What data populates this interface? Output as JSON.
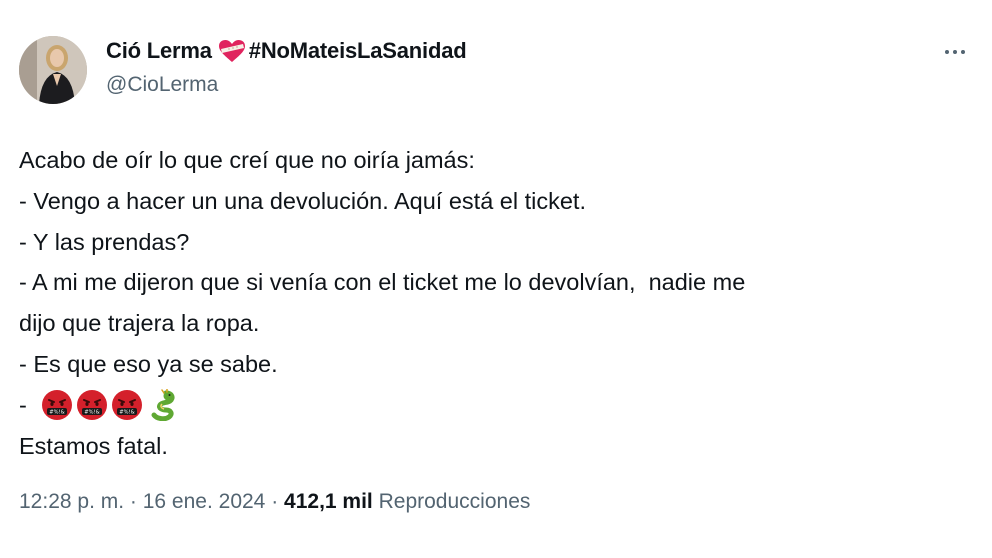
{
  "author": {
    "name": "Ció Lerma",
    "hashtag": "#NoMateisLaSanidad",
    "handle": "@CioLerma",
    "avatar_icon": "profile-photo"
  },
  "tweet": {
    "lines": [
      "Acabo de oír lo que creí que no oiría jamás:",
      "- Vengo a hacer un una devolución. Aquí está el ticket.",
      "- Y las prendas?",
      "- A mi me dijeron que si venía con el ticket me lo devolvían,  nadie me",
      "dijo que trajera la ropa.",
      "- Es que eso ya se sabe."
    ],
    "emoji_line_prefix": "-",
    "emojis": [
      "face-with-symbols-on-mouth-icon",
      "face-with-symbols-on-mouth-icon",
      "face-with-symbols-on-mouth-icon",
      "dragon-icon"
    ],
    "last_line": "Estamos fatal."
  },
  "meta": {
    "time": "12:28 p. m.",
    "separator": " · ",
    "date": "16 ene. 2024",
    "views_count": "412,1 mil",
    "views_label": "Reproducciones"
  },
  "colors": {
    "text": "#0f1419",
    "secondary": "#536471",
    "heart": "#e0245e",
    "emoji_red": "#d4202b",
    "dragon": "#5fa833"
  }
}
